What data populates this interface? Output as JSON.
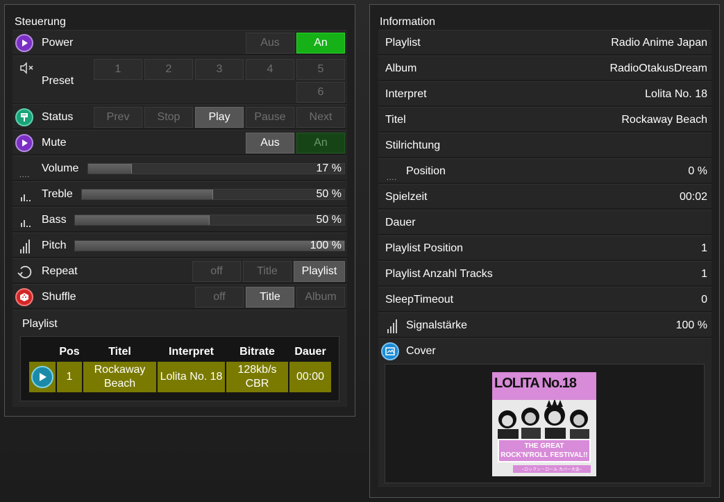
{
  "control": {
    "title": "Steuerung",
    "power": {
      "label": "Power",
      "off": "Aus",
      "on": "An"
    },
    "preset": {
      "label": "Preset",
      "buttons": [
        "1",
        "2",
        "3",
        "4",
        "5",
        "6"
      ]
    },
    "status": {
      "label": "Status",
      "buttons": [
        "Prev",
        "Stop",
        "Play",
        "Pause",
        "Next"
      ]
    },
    "mute": {
      "label": "Mute",
      "off": "Aus",
      "on": "An"
    },
    "volume": {
      "label": "Volume",
      "value": "17 %",
      "fraction": 0.17
    },
    "treble": {
      "label": "Treble",
      "value": "50 %",
      "fraction": 0.5
    },
    "bass": {
      "label": "Bass",
      "value": "50 %",
      "fraction": 0.5
    },
    "pitch": {
      "label": "Pitch",
      "value": "100 %",
      "fraction": 1.0
    },
    "repeat": {
      "label": "Repeat",
      "buttons": [
        "off",
        "Title",
        "Playlist"
      ]
    },
    "shuffle": {
      "label": "Shuffle",
      "buttons": [
        "off",
        "Title",
        "Album"
      ]
    },
    "playlist": {
      "title": "Playlist",
      "headers": [
        "Pos",
        "Titel",
        "Interpret",
        "Bitrate",
        "Dauer"
      ],
      "rows": [
        {
          "pos": "1",
          "title": "Rockaway Beach",
          "artist": "Lolita No. 18",
          "bitrate": "128kb/s CBR",
          "duration": "00:00"
        }
      ]
    }
  },
  "info": {
    "title": "Information",
    "rows": [
      {
        "label": "Playlist",
        "value": "Radio Anime Japan"
      },
      {
        "label": "Album",
        "value": "RadioOtakusDream"
      },
      {
        "label": "Interpret",
        "value": "Lolita No. 18"
      },
      {
        "label": "Titel",
        "value": "Rockaway Beach"
      },
      {
        "label": "Stilrichtung",
        "value": ""
      },
      {
        "label": "Position",
        "value": "0 %"
      },
      {
        "label": "Spielzeit",
        "value": "00:02"
      },
      {
        "label": "Dauer",
        "value": ""
      },
      {
        "label": "Playlist Position",
        "value": "1"
      },
      {
        "label": "Playlist Anzahl Tracks",
        "value": "1"
      },
      {
        "label": "SleepTimeout",
        "value": "0"
      },
      {
        "label": "Signalstärke",
        "value": "100 %"
      }
    ],
    "cover": {
      "label": "Cover",
      "art_title": "LOLITA No.18",
      "art_banner": "THE GREAT ROCK'N'ROLL FESTIVAL!!",
      "art_subtitle": "~ロックン・ロール カバー大会~"
    }
  },
  "colors": {
    "green": "#16b116",
    "purple": "#7b2fc4",
    "teal": "#1aa37a",
    "red": "#d42626",
    "blue": "#1a8ad4",
    "olive": "#7a7a00"
  }
}
